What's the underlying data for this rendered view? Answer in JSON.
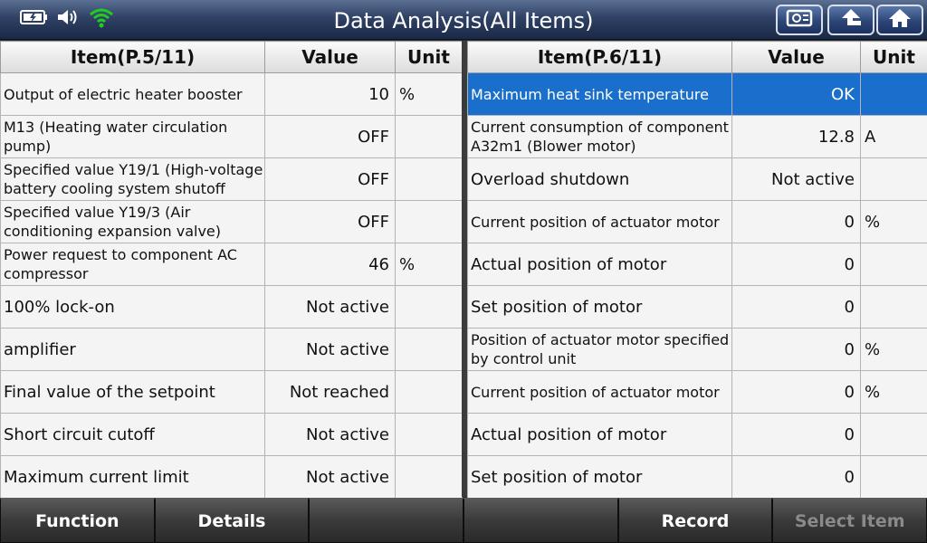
{
  "header": {
    "title": "Data Analysis(All Items)",
    "icons": {
      "battery": "battery-charging-icon",
      "volume": "speaker-volume-icon",
      "wifi": "wifi-icon",
      "screenshot": "screenshot-icon",
      "back": "back-arrow-icon",
      "home": "home-icon"
    },
    "wifi_color": "#22cc22"
  },
  "left_table": {
    "headers": {
      "item": "Item(P.5/11)",
      "value": "Value",
      "unit": "Unit"
    },
    "rows": [
      {
        "item": "Output of electric heater booster",
        "value": "10",
        "unit": "%"
      },
      {
        "item": "M13 (Heating water circulation pump)",
        "value": "OFF",
        "unit": ""
      },
      {
        "item": "Specified value Y19/1 (High-voltage battery cooling system shutoff",
        "value": "OFF",
        "unit": ""
      },
      {
        "item": "Specified value Y19/3 (Air conditioning expansion valve)",
        "value": "OFF",
        "unit": ""
      },
      {
        "item": "Power request to component AC compressor",
        "value": "46",
        "unit": "%"
      },
      {
        "item": "100% lock-on",
        "value": "Not active",
        "unit": ""
      },
      {
        "item": "amplifier",
        "value": "Not active",
        "unit": ""
      },
      {
        "item": "Final value of the setpoint",
        "value": "Not reached",
        "unit": ""
      },
      {
        "item": "Short circuit cutoff",
        "value": "Not active",
        "unit": ""
      },
      {
        "item": "Maximum current limit",
        "value": "Not active",
        "unit": ""
      }
    ]
  },
  "right_table": {
    "headers": {
      "item": "Item(P.6/11)",
      "value": "Value",
      "unit": "Unit"
    },
    "rows": [
      {
        "item": "Maximum heat sink temperature",
        "value": "OK",
        "unit": ""
      },
      {
        "item": "Current consumption of component A32m1 (Blower motor)",
        "value": "12.8",
        "unit": "A"
      },
      {
        "item": "Overload shutdown",
        "value": "Not active",
        "unit": ""
      },
      {
        "item": "Current position of actuator motor",
        "value": "0",
        "unit": "%"
      },
      {
        "item": "Actual position of motor",
        "value": "0",
        "unit": ""
      },
      {
        "item": "Set position of motor",
        "value": "0",
        "unit": ""
      },
      {
        "item": "Position of actuator motor specified by control unit",
        "value": "0",
        "unit": "%"
      },
      {
        "item": "Current position of actuator motor",
        "value": "0",
        "unit": "%"
      },
      {
        "item": "Actual position of motor",
        "value": "0",
        "unit": ""
      },
      {
        "item": "Set position of motor",
        "value": "0",
        "unit": ""
      }
    ],
    "selected_row": 0,
    "selected_color": "#1a6fcc"
  },
  "footer": {
    "buttons": [
      "Function",
      "Details",
      "",
      "",
      "Record",
      "Select Item"
    ]
  }
}
